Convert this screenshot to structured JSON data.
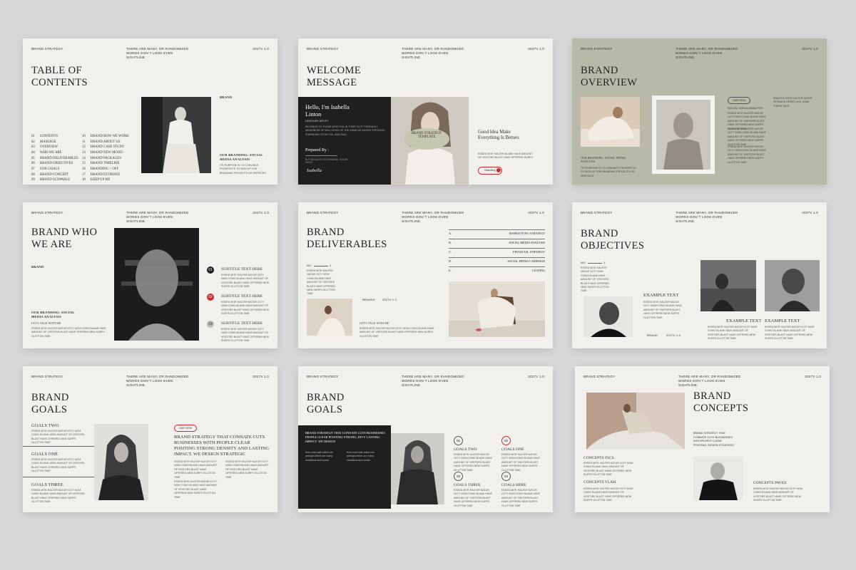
{
  "header": {
    "left": "BRAND STRATEGY",
    "middle": "THERE ARE MANY, OR RANDOMIZED WORDS DON`T LOOK EVEN SIGHTLINE.",
    "right": "2027V 1.0"
  },
  "lorem": "ESSED MITE HALTER NATUR OLTY NOM COMO BLANK HAVE AMOUNT OF VISITORS BLAST HAVE OFFERED NEW SURFS GLUTTON TIME",
  "s1": {
    "title": "TABLE OF CONTENTS",
    "brand": "BRAND",
    "toc_left": [
      {
        "n": "01",
        "t": "CONTENTS"
      },
      {
        "n": "02",
        "t": "MASSAGE"
      },
      {
        "n": "03",
        "t": "OVERVIEW"
      },
      {
        "n": "04",
        "t": "WHO WE ARE"
      },
      {
        "n": "05",
        "t": "BRAND DELIVERABLES"
      },
      {
        "n": "06",
        "t": "BRAND OBJECTIVES"
      },
      {
        "n": "07",
        "t": "OUR GOALS"
      },
      {
        "n": "08",
        "t": "BRAND CONCEPT"
      },
      {
        "n": "09",
        "t": "BRAND SCOPABLE"
      }
    ],
    "toc_right": [
      {
        "n": "10",
        "t": "BRAND HOW WE WORK"
      },
      {
        "n": "11",
        "t": "BRAND ABOUT US"
      },
      {
        "n": "12",
        "t": "BRAND CASE STUDY"
      },
      {
        "n": "13",
        "t": "BRAND NEW MOOD"
      },
      {
        "n": "14",
        "t": "BRAND PACKAGES"
      },
      {
        "n": "15",
        "t": "BRAND TIMELINE"
      },
      {
        "n": "16",
        "t": "BRANDING + OFF"
      },
      {
        "n": "17",
        "t": "BRAND ESTIMATE"
      },
      {
        "n": "18",
        "t": "KEEP UP ME"
      }
    ],
    "branding_title": "OUR BRANDING: SOCIAL MEDIA ANALYSIS",
    "branding_text": "ITS PURPOSE IS TO CONVINCE PROSPECTS TO SIGN UP FOR BRANDING PROJECTS OR SERVICES."
  },
  "s2": {
    "title": "WELCOME MESSAGE",
    "hello": "Hello, I'm Isabella Linton",
    "role": "DESIGNER ARTIST",
    "body": "BELONGS TO THOSE WHO FAIL IN THEIR DUTY THROUGH WEAKNESS OF WILL WHICH IS THE SAME AS SAYING THROUGH SHRINKING FROM TOIL AND PAIN.",
    "prepared": "Prepared By :",
    "prepared_sub": "BUT BECAUSE OCCASIONAL SOLAR SINCE",
    "signature": "Isabella",
    "badge": "BRAND STRATEGY TEMPLATE",
    "idea": "Good Idea Make Everything Is Betters",
    "idea_text": "ESSED MITE HALTER BLANK HAVE AMOUNT OF VISITORS BLAST HAVE OFFERED SURFS",
    "pill": "Branding"
  },
  "s3": {
    "title": "BRAND OVERVIEW",
    "pill": "OUR VIEW",
    "social_title": "SOCIAL MEDIA ANALYSIS",
    "social_text": "SNAZZLE DATE HALTER NATUR STRANGE GREAT LIKE SOME THERE TAKE",
    "cap_title": "OUR BRANDING: SOCIAL MEDIA ANALYSIS",
    "cap_text": "ITS PURPOSE IS TO CONVINCE PROSPECTS TO SIGN UP FOR BRANDING PROJECTS OR SERVICES."
  },
  "s4": {
    "title": "BRAND WHO WE ARE",
    "brand": "BRAND",
    "branding_title": "OUR BRANDING: SOCIAL MEDIA ANALYSIS",
    "sub": "LET'S TALK WITH ME",
    "items": [
      {
        "n": "01",
        "t": "SUBTITLE TEXT HERE",
        "color": "#1e1e1e"
      },
      {
        "n": "02",
        "t": "SUBTITLE TEXT HERE",
        "color": "#cf2a2a"
      },
      {
        "n": "03",
        "t": "SUBTITLE TEXT HERE",
        "color": "#bfbdb2"
      }
    ]
  },
  "s5": {
    "title": "BRAND DELIVERABLES",
    "no": "NO.",
    "no_val": "1",
    "list": [
      {
        "k": "A.",
        "v": "MARKETTING STRATEGY"
      },
      {
        "k": "B.",
        "v": "SOCIAL MEDIA ANALYSIS"
      },
      {
        "k": "C.",
        "v": "FINANCIAL STRATEGY"
      },
      {
        "k": "D.",
        "v": "SOCIAL MEDIA CAMPAIGN"
      },
      {
        "k": "E.",
        "v": "CLOSING"
      }
    ],
    "links": [
      "BRANDS",
      "2027V 1.0"
    ],
    "sub": "LET'S TALK WITH ME"
  },
  "s6": {
    "title": "BRAND OBJECTIVES",
    "no": "NO.",
    "no_val": "1",
    "ex1": "EXAMPLE TEXT",
    "ex2": "EXAMPLE TEXT",
    "ex3": "EXAMPLE TEXT",
    "links": [
      "BRAND",
      "2027V 1.0"
    ]
  },
  "s7": {
    "title": "BRAND GOALS",
    "goals": [
      "GOALS TWO",
      "GOALS ONE",
      "GOALS THREE"
    ],
    "pill": "OUR VIEW",
    "headline": "BRAND STRATEGY THAT CONNATE CUTS BUSINESSES WITH PEOPLE CLEAR POSITING STRONG DENSITY AND LASTING IMPACT. WE DESIGN STRATEGIC"
  },
  "s8": {
    "title": "BRAND GOALS",
    "box_title": "BRAND STRATEGY THAT CONNATE CUTS BUSINESSES PEOPLE CLEAR POSITING STRONG, DIVY LASTING IMPACT. WE DESIGN",
    "box_text": "from mod sale sullot con perhaps there are many variations and words",
    "nums": [
      "01",
      "02",
      "03",
      "04"
    ],
    "goals": [
      "GOALS TWO",
      "GOALS ONE",
      "GOALS THREE",
      "GOALS HERE"
    ]
  },
  "s9": {
    "title": "BRAND CONCEPTS",
    "intro": "BRAND STRATEGY THAT CONNATE CUTS BUSINESSES WITH PEOPLE CLEAR POSITING, DESIGN STRATEGIC",
    "c1": "CONCEPTS INCS",
    "c2": "CONCEPTS YLAH",
    "c3": "CONCEPTS PAVES"
  }
}
